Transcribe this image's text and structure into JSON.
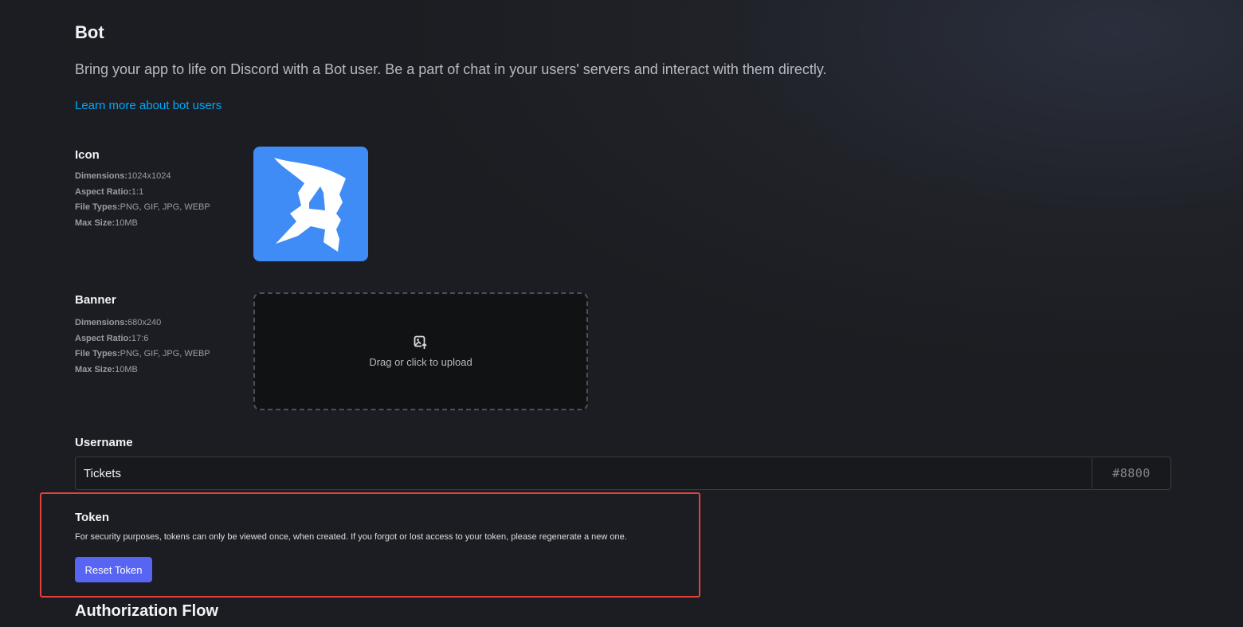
{
  "header": {
    "title": "Bot",
    "subtitle": "Bring your app to life on Discord with a Bot user. Be a part of chat in your users' servers and interact with them directly.",
    "learn_more_link": "Learn more about bot users"
  },
  "icon": {
    "label": "Icon",
    "dimensions_key": "Dimensions:",
    "dimensions_value": "1024x1024",
    "aspect_key": "Aspect Ratio:",
    "aspect_value": "1:1",
    "filetypes_key": "File Types:",
    "filetypes_value": "PNG, GIF, JPG, WEBP",
    "maxsize_key": "Max Size:",
    "maxsize_value": "10MB",
    "image_bg_color": "#3f8cf7"
  },
  "banner": {
    "label": "Banner",
    "dimensions_key": "Dimensions:",
    "dimensions_value": "680x240",
    "aspect_key": "Aspect Ratio:",
    "aspect_value": "17:6",
    "filetypes_key": "File Types:",
    "filetypes_value": "PNG, GIF, JPG, WEBP",
    "maxsize_key": "Max Size:",
    "maxsize_value": "10MB",
    "upload_text": "Drag or click to upload",
    "upload_icon": "image-upload-icon"
  },
  "username": {
    "label": "Username",
    "value": "Tickets",
    "discriminator": "#8800"
  },
  "token": {
    "label": "Token",
    "description": "For security purposes, tokens can only be viewed once, when created. If you forgot or lost access to your token, please regenerate a new one.",
    "reset_button": "Reset Token",
    "highlight_color": "#e5413c"
  },
  "authorization": {
    "title": "Authorization Flow"
  },
  "colors": {
    "accent": "#5865f2",
    "link": "#00a8fc"
  }
}
